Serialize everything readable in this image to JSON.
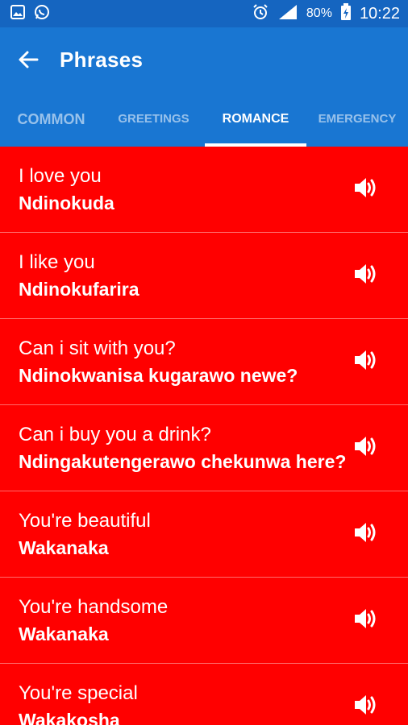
{
  "status_bar": {
    "icons": [
      "image-icon",
      "whatsapp-icon",
      "alarm-icon",
      "signal-icon",
      "battery-charging-icon"
    ],
    "battery": "80%",
    "time": "10:22"
  },
  "app_bar": {
    "title": "Phrases",
    "back_icon": "arrow-left-icon"
  },
  "tabs": [
    {
      "label": "COMMON",
      "selected": false
    },
    {
      "label": "GREETINGS",
      "selected": false
    },
    {
      "label": "ROMANCE",
      "selected": true
    },
    {
      "label": "EMERGENCY",
      "selected": false
    }
  ],
  "phrases": [
    {
      "english": "I love you",
      "translation": "Ndinokuda"
    },
    {
      "english": "I like you",
      "translation": "Ndinokufarira"
    },
    {
      "english": "Can i sit with you?",
      "translation": "Ndinokwanisa kugarawo newe?"
    },
    {
      "english": "Can i buy you a drink?",
      "translation": "Ndingakutengerawo chekunwa here?"
    },
    {
      "english": "You're beautiful",
      "translation": "Wakanaka"
    },
    {
      "english": "You're handsome",
      "translation": "Wakanaka"
    },
    {
      "english": "You're special",
      "translation": "Wakakosha"
    }
  ],
  "colors": {
    "status_bar": "#1565c0",
    "app_bar": "#1976d2",
    "row_background": "#ff0000",
    "row_divider": "#ff6b6b"
  }
}
